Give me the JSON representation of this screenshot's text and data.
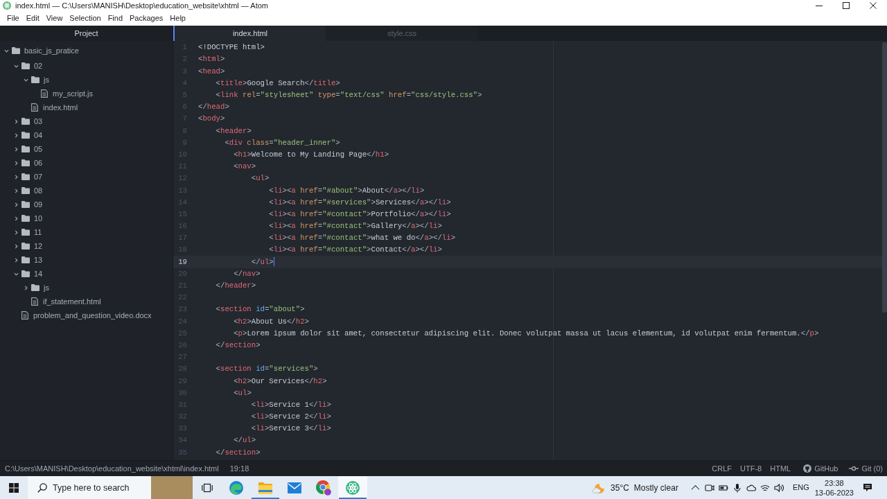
{
  "window": {
    "title": "index.html — C:\\Users\\MANISH\\Desktop\\education_website\\xhtml — Atom"
  },
  "menu_bar": [
    "File",
    "Edit",
    "View",
    "Selection",
    "Find",
    "Packages",
    "Help"
  ],
  "tree_view": {
    "title": "Project",
    "items": [
      {
        "kind": "folder",
        "label": "basic_js_pratice",
        "expanded": true,
        "children": [
          {
            "kind": "folder",
            "label": "02",
            "expanded": true,
            "children": [
              {
                "kind": "folder",
                "label": "js",
                "expanded": true,
                "children": [
                  {
                    "kind": "file",
                    "label": "my_script.js"
                  }
                ]
              },
              {
                "kind": "file",
                "label": "index.html"
              }
            ]
          },
          {
            "kind": "folder",
            "label": "03",
            "expanded": false
          },
          {
            "kind": "folder",
            "label": "04",
            "expanded": false
          },
          {
            "kind": "folder",
            "label": "05",
            "expanded": false
          },
          {
            "kind": "folder",
            "label": "06",
            "expanded": false
          },
          {
            "kind": "folder",
            "label": "07",
            "expanded": false
          },
          {
            "kind": "folder",
            "label": "08",
            "expanded": false
          },
          {
            "kind": "folder",
            "label": "09",
            "expanded": false
          },
          {
            "kind": "folder",
            "label": "10",
            "expanded": false
          },
          {
            "kind": "folder",
            "label": "11",
            "expanded": false
          },
          {
            "kind": "folder",
            "label": "12",
            "expanded": false
          },
          {
            "kind": "folder",
            "label": "13",
            "expanded": false
          },
          {
            "kind": "folder",
            "label": "14",
            "expanded": true,
            "children": [
              {
                "kind": "folder",
                "label": "js",
                "expanded": false
              },
              {
                "kind": "file",
                "label": "if_statement.html"
              }
            ]
          },
          {
            "kind": "file",
            "label": "problem_and_question_video.docx"
          }
        ]
      }
    ]
  },
  "tabs": [
    {
      "label": "index.html",
      "selected": true
    },
    {
      "label": "style.css",
      "selected": false
    }
  ],
  "editor": {
    "lines": [
      {
        "number": "1",
        "current": false,
        "tokens": [
          {
            "kind": "doctype",
            "text": "<!DOCTYPE html>"
          }
        ]
      },
      {
        "number": "2",
        "current": false,
        "tokens": [
          {
            "kind": "punct",
            "text": "<"
          },
          {
            "kind": "tag",
            "text": "html"
          },
          {
            "kind": "punct",
            "text": ">"
          }
        ]
      },
      {
        "number": "3",
        "current": false,
        "tokens": [
          {
            "kind": "punct",
            "text": "<"
          },
          {
            "kind": "tag",
            "text": "head"
          },
          {
            "kind": "punct",
            "text": ">"
          }
        ]
      },
      {
        "number": "4",
        "current": false,
        "tokens": [
          {
            "kind": "punct",
            "text": "    <"
          },
          {
            "kind": "tag",
            "text": "title"
          },
          {
            "kind": "punct",
            "text": ">"
          },
          {
            "kind": "text",
            "text": "Google Search"
          },
          {
            "kind": "punct",
            "text": "</"
          },
          {
            "kind": "tag",
            "text": "title"
          },
          {
            "kind": "punct",
            "text": ">"
          }
        ]
      },
      {
        "number": "5",
        "current": false,
        "tokens": [
          {
            "kind": "punct",
            "text": "    <"
          },
          {
            "kind": "tag",
            "text": "link"
          },
          {
            "kind": "attr",
            "text": " rel"
          },
          {
            "kind": "punct",
            "text": "="
          },
          {
            "kind": "string",
            "text": "\"stylesheet\""
          },
          {
            "kind": "attr",
            "text": " type"
          },
          {
            "kind": "punct",
            "text": "="
          },
          {
            "kind": "string",
            "text": "\"text/css\""
          },
          {
            "kind": "attr",
            "text": " href"
          },
          {
            "kind": "punct",
            "text": "="
          },
          {
            "kind": "string",
            "text": "\"css/style.css\""
          },
          {
            "kind": "punct",
            "text": ">"
          }
        ]
      },
      {
        "number": "6",
        "current": false,
        "tokens": [
          {
            "kind": "punct",
            "text": "</"
          },
          {
            "kind": "tag",
            "text": "head"
          },
          {
            "kind": "punct",
            "text": ">"
          }
        ]
      },
      {
        "number": "7",
        "current": false,
        "tokens": [
          {
            "kind": "punct",
            "text": "<"
          },
          {
            "kind": "tag",
            "text": "body"
          },
          {
            "kind": "punct",
            "text": ">"
          }
        ]
      },
      {
        "number": "8",
        "current": false,
        "tokens": [
          {
            "kind": "punct",
            "text": "    <"
          },
          {
            "kind": "tag",
            "text": "header"
          },
          {
            "kind": "punct",
            "text": ">"
          }
        ]
      },
      {
        "number": "9",
        "current": false,
        "tokens": [
          {
            "kind": "punct",
            "text": "      <"
          },
          {
            "kind": "tag",
            "text": "div"
          },
          {
            "kind": "attr",
            "text": " class"
          },
          {
            "kind": "punct",
            "text": "="
          },
          {
            "kind": "string",
            "text": "\"header_inner\""
          },
          {
            "kind": "punct",
            "text": ">"
          }
        ]
      },
      {
        "number": "10",
        "current": false,
        "tokens": [
          {
            "kind": "punct",
            "text": "        <"
          },
          {
            "kind": "tag",
            "text": "h1"
          },
          {
            "kind": "punct",
            "text": ">"
          },
          {
            "kind": "text",
            "text": "Welcome to My Landing Page"
          },
          {
            "kind": "punct",
            "text": "</"
          },
          {
            "kind": "tag",
            "text": "h1"
          },
          {
            "kind": "punct",
            "text": ">"
          }
        ]
      },
      {
        "number": "11",
        "current": false,
        "tokens": [
          {
            "kind": "punct",
            "text": "        <"
          },
          {
            "kind": "tag",
            "text": "nav"
          },
          {
            "kind": "punct",
            "text": ">"
          }
        ]
      },
      {
        "number": "12",
        "current": false,
        "tokens": [
          {
            "kind": "punct",
            "text": "            <"
          },
          {
            "kind": "tag",
            "text": "ul"
          },
          {
            "kind": "punct",
            "text": ">"
          }
        ]
      },
      {
        "number": "13",
        "current": false,
        "tokens": [
          {
            "kind": "punct",
            "text": "                <"
          },
          {
            "kind": "tag",
            "text": "li"
          },
          {
            "kind": "punct",
            "text": "><"
          },
          {
            "kind": "tag",
            "text": "a"
          },
          {
            "kind": "attr",
            "text": " href"
          },
          {
            "kind": "punct",
            "text": "="
          },
          {
            "kind": "string",
            "text": "\"#about\""
          },
          {
            "kind": "punct",
            "text": ">"
          },
          {
            "kind": "text",
            "text": "About"
          },
          {
            "kind": "punct",
            "text": "</"
          },
          {
            "kind": "tag",
            "text": "a"
          },
          {
            "kind": "punct",
            "text": "></"
          },
          {
            "kind": "tag",
            "text": "li"
          },
          {
            "kind": "punct",
            "text": ">"
          }
        ]
      },
      {
        "number": "14",
        "current": false,
        "tokens": [
          {
            "kind": "punct",
            "text": "                <"
          },
          {
            "kind": "tag",
            "text": "li"
          },
          {
            "kind": "punct",
            "text": "><"
          },
          {
            "kind": "tag",
            "text": "a"
          },
          {
            "kind": "attr",
            "text": " href"
          },
          {
            "kind": "punct",
            "text": "="
          },
          {
            "kind": "string",
            "text": "\"#services\""
          },
          {
            "kind": "punct",
            "text": ">"
          },
          {
            "kind": "text",
            "text": "Services"
          },
          {
            "kind": "punct",
            "text": "</"
          },
          {
            "kind": "tag",
            "text": "a"
          },
          {
            "kind": "punct",
            "text": "></"
          },
          {
            "kind": "tag",
            "text": "li"
          },
          {
            "kind": "punct",
            "text": ">"
          }
        ]
      },
      {
        "number": "15",
        "current": false,
        "tokens": [
          {
            "kind": "punct",
            "text": "                <"
          },
          {
            "kind": "tag",
            "text": "li"
          },
          {
            "kind": "punct",
            "text": "><"
          },
          {
            "kind": "tag",
            "text": "a"
          },
          {
            "kind": "attr",
            "text": " href"
          },
          {
            "kind": "punct",
            "text": "="
          },
          {
            "kind": "string",
            "text": "\"#contact\""
          },
          {
            "kind": "punct",
            "text": ">"
          },
          {
            "kind": "text",
            "text": "Portfolio"
          },
          {
            "kind": "punct",
            "text": "</"
          },
          {
            "kind": "tag",
            "text": "a"
          },
          {
            "kind": "punct",
            "text": "></"
          },
          {
            "kind": "tag",
            "text": "li"
          },
          {
            "kind": "punct",
            "text": ">"
          }
        ]
      },
      {
        "number": "16",
        "current": false,
        "tokens": [
          {
            "kind": "punct",
            "text": "                <"
          },
          {
            "kind": "tag",
            "text": "li"
          },
          {
            "kind": "punct",
            "text": "><"
          },
          {
            "kind": "tag",
            "text": "a"
          },
          {
            "kind": "attr",
            "text": " href"
          },
          {
            "kind": "punct",
            "text": "="
          },
          {
            "kind": "string",
            "text": "\"#contact\""
          },
          {
            "kind": "punct",
            "text": ">"
          },
          {
            "kind": "text",
            "text": "Gallery"
          },
          {
            "kind": "punct",
            "text": "</"
          },
          {
            "kind": "tag",
            "text": "a"
          },
          {
            "kind": "punct",
            "text": "></"
          },
          {
            "kind": "tag",
            "text": "li"
          },
          {
            "kind": "punct",
            "text": ">"
          }
        ]
      },
      {
        "number": "17",
        "current": false,
        "tokens": [
          {
            "kind": "punct",
            "text": "                <"
          },
          {
            "kind": "tag",
            "text": "li"
          },
          {
            "kind": "punct",
            "text": "><"
          },
          {
            "kind": "tag",
            "text": "a"
          },
          {
            "kind": "attr",
            "text": " href"
          },
          {
            "kind": "punct",
            "text": "="
          },
          {
            "kind": "string",
            "text": "\"#contact\""
          },
          {
            "kind": "punct",
            "text": ">"
          },
          {
            "kind": "text",
            "text": "what we do"
          },
          {
            "kind": "punct",
            "text": "</"
          },
          {
            "kind": "tag",
            "text": "a"
          },
          {
            "kind": "punct",
            "text": "></"
          },
          {
            "kind": "tag",
            "text": "li"
          },
          {
            "kind": "punct",
            "text": ">"
          }
        ]
      },
      {
        "number": "18",
        "current": false,
        "tokens": [
          {
            "kind": "punct",
            "text": "                <"
          },
          {
            "kind": "tag",
            "text": "li"
          },
          {
            "kind": "punct",
            "text": "><"
          },
          {
            "kind": "tag",
            "text": "a"
          },
          {
            "kind": "attr",
            "text": " href"
          },
          {
            "kind": "punct",
            "text": "="
          },
          {
            "kind": "string",
            "text": "\"#contact\""
          },
          {
            "kind": "punct",
            "text": ">"
          },
          {
            "kind": "text",
            "text": "Contact"
          },
          {
            "kind": "punct",
            "text": "</"
          },
          {
            "kind": "tag",
            "text": "a"
          },
          {
            "kind": "punct",
            "text": "></"
          },
          {
            "kind": "tag",
            "text": "li"
          },
          {
            "kind": "punct",
            "text": ">"
          }
        ]
      },
      {
        "number": "19",
        "current": true,
        "tokens": [
          {
            "kind": "punct",
            "text": "            </"
          },
          {
            "kind": "tag",
            "text": "ul"
          },
          {
            "kind": "punct",
            "text": ">"
          }
        ]
      },
      {
        "number": "20",
        "current": false,
        "tokens": [
          {
            "kind": "punct",
            "text": "        </"
          },
          {
            "kind": "tag",
            "text": "nav"
          },
          {
            "kind": "punct",
            "text": ">"
          }
        ]
      },
      {
        "number": "21",
        "current": false,
        "tokens": [
          {
            "kind": "punct",
            "text": "    </"
          },
          {
            "kind": "tag",
            "text": "header"
          },
          {
            "kind": "punct",
            "text": ">"
          }
        ]
      },
      {
        "number": "22",
        "current": false
      },
      {
        "number": "23",
        "current": false,
        "tokens": [
          {
            "kind": "punct",
            "text": "    <"
          },
          {
            "kind": "tag",
            "text": "section"
          },
          {
            "kind": "attr_id",
            "text": " id"
          },
          {
            "kind": "punct",
            "text": "="
          },
          {
            "kind": "string",
            "text": "\"about\""
          },
          {
            "kind": "punct",
            "text": ">"
          }
        ]
      },
      {
        "number": "24",
        "current": false,
        "tokens": [
          {
            "kind": "punct",
            "text": "        <"
          },
          {
            "kind": "tag",
            "text": "h2"
          },
          {
            "kind": "punct",
            "text": ">"
          },
          {
            "kind": "text",
            "text": "About Us"
          },
          {
            "kind": "punct",
            "text": "</"
          },
          {
            "kind": "tag",
            "text": "h2"
          },
          {
            "kind": "punct",
            "text": ">"
          }
        ]
      },
      {
        "number": "25",
        "current": false,
        "tokens": [
          {
            "kind": "punct",
            "text": "        <"
          },
          {
            "kind": "tag",
            "text": "p"
          },
          {
            "kind": "punct",
            "text": ">"
          },
          {
            "kind": "text",
            "text": "Lorem ipsum dolor sit amet, consectetur adipiscing elit. Donec volutpat massa ut lacus elementum, id volutpat enim fermentum."
          },
          {
            "kind": "punct",
            "text": "</"
          },
          {
            "kind": "tag",
            "text": "p"
          },
          {
            "kind": "punct",
            "text": ">"
          }
        ]
      },
      {
        "number": "26",
        "current": false,
        "tokens": [
          {
            "kind": "punct",
            "text": "    </"
          },
          {
            "kind": "tag",
            "text": "section"
          },
          {
            "kind": "punct",
            "text": ">"
          }
        ]
      },
      {
        "number": "27",
        "current": false
      },
      {
        "number": "28",
        "current": false,
        "tokens": [
          {
            "kind": "punct",
            "text": "    <"
          },
          {
            "kind": "tag",
            "text": "section"
          },
          {
            "kind": "attr_id",
            "text": " id"
          },
          {
            "kind": "punct",
            "text": "="
          },
          {
            "kind": "string",
            "text": "\"services\""
          },
          {
            "kind": "punct",
            "text": ">"
          }
        ]
      },
      {
        "number": "29",
        "current": false,
        "tokens": [
          {
            "kind": "punct",
            "text": "        <"
          },
          {
            "kind": "tag",
            "text": "h2"
          },
          {
            "kind": "punct",
            "text": ">"
          },
          {
            "kind": "text",
            "text": "Our Services"
          },
          {
            "kind": "punct",
            "text": "</"
          },
          {
            "kind": "tag",
            "text": "h2"
          },
          {
            "kind": "punct",
            "text": ">"
          }
        ]
      },
      {
        "number": "30",
        "current": false,
        "tokens": [
          {
            "kind": "punct",
            "text": "        <"
          },
          {
            "kind": "tag",
            "text": "ul"
          },
          {
            "kind": "punct",
            "text": ">"
          }
        ]
      },
      {
        "number": "31",
        "current": false,
        "tokens": [
          {
            "kind": "punct",
            "text": "            <"
          },
          {
            "kind": "tag",
            "text": "li"
          },
          {
            "kind": "punct",
            "text": ">"
          },
          {
            "kind": "text",
            "text": "Service 1"
          },
          {
            "kind": "punct",
            "text": "</"
          },
          {
            "kind": "tag",
            "text": "li"
          },
          {
            "kind": "punct",
            "text": ">"
          }
        ]
      },
      {
        "number": "32",
        "current": false,
        "tokens": [
          {
            "kind": "punct",
            "text": "            <"
          },
          {
            "kind": "tag",
            "text": "li"
          },
          {
            "kind": "punct",
            "text": ">"
          },
          {
            "kind": "text",
            "text": "Service 2"
          },
          {
            "kind": "punct",
            "text": "</"
          },
          {
            "kind": "tag",
            "text": "li"
          },
          {
            "kind": "punct",
            "text": ">"
          }
        ]
      },
      {
        "number": "33",
        "current": false,
        "tokens": [
          {
            "kind": "punct",
            "text": "            <"
          },
          {
            "kind": "tag",
            "text": "li"
          },
          {
            "kind": "punct",
            "text": ">"
          },
          {
            "kind": "text",
            "text": "Service 3"
          },
          {
            "kind": "punct",
            "text": "</"
          },
          {
            "kind": "tag",
            "text": "li"
          },
          {
            "kind": "punct",
            "text": ">"
          }
        ]
      },
      {
        "number": "34",
        "current": false,
        "tokens": [
          {
            "kind": "punct",
            "text": "        </"
          },
          {
            "kind": "tag",
            "text": "ul"
          },
          {
            "kind": "punct",
            "text": ">"
          }
        ]
      },
      {
        "number": "35",
        "current": false,
        "tokens": [
          {
            "kind": "punct",
            "text": "    </"
          },
          {
            "kind": "tag",
            "text": "section"
          },
          {
            "kind": "punct",
            "text": ">"
          }
        ]
      }
    ]
  },
  "status_bar": {
    "file_path": "C:\\Users\\MANISH\\Desktop\\education_website\\xhtml\\index.html",
    "cursor_position": "19:18",
    "line_ending": "CRLF",
    "encoding": "UTF-8",
    "grammar": "HTML",
    "github": "GitHub",
    "git": "Git (0)"
  },
  "taskbar": {
    "search": {
      "placeholder": "Type here to search"
    },
    "apps": [
      {
        "kind": "edge",
        "running": false,
        "selected": false
      },
      {
        "kind": "explorer",
        "running": true,
        "selected": false
      },
      {
        "kind": "mail",
        "running": false,
        "selected": false
      },
      {
        "kind": "chrome",
        "running": false,
        "selected": false
      },
      {
        "kind": "atom",
        "running": true,
        "selected": true
      }
    ],
    "weather": {
      "temperature": "35°C",
      "condition": "Mostly clear"
    },
    "language": "ENG",
    "clock": {
      "time": "23:38",
      "date": "13-06-2023"
    }
  }
}
